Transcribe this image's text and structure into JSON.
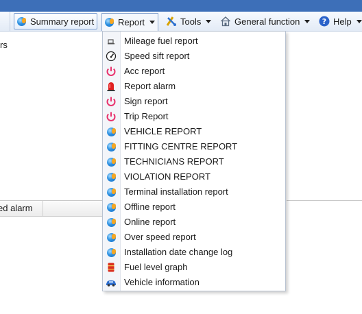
{
  "toolbar": {
    "items": [
      {
        "label": "Summary report",
        "icon": "globe-icon"
      },
      {
        "label": "Report",
        "icon": "globe-icon"
      },
      {
        "label": "Tools",
        "icon": "tools-icon"
      },
      {
        "label": "General function",
        "icon": "home-icon"
      },
      {
        "label": "Help",
        "icon": "help-icon"
      }
    ]
  },
  "left_panel": {
    "text": "rs"
  },
  "grid": {
    "column_header": "ed alarm"
  },
  "report_menu": {
    "items": [
      {
        "label": "Mileage fuel report",
        "icon": "fuel-pump-icon"
      },
      {
        "label": "Speed sift report",
        "icon": "speedometer-icon"
      },
      {
        "label": "Acc report",
        "icon": "power-icon"
      },
      {
        "label": "Report alarm",
        "icon": "alarm-siren-icon"
      },
      {
        "label": "Sign report",
        "icon": "power-icon"
      },
      {
        "label": "Trip Report",
        "icon": "power-icon"
      },
      {
        "label": "VEHICLE REPORT",
        "icon": "globe-icon"
      },
      {
        "label": "FITTING CENTRE REPORT",
        "icon": "globe-icon"
      },
      {
        "label": "TECHNICIANS REPORT",
        "icon": "globe-icon"
      },
      {
        "label": "VIOLATION REPORT",
        "icon": "globe-icon"
      },
      {
        "label": "Terminal installation report",
        "icon": "globe-icon"
      },
      {
        "label": "Offline report",
        "icon": "globe-icon"
      },
      {
        "label": "Online report",
        "icon": "globe-icon"
      },
      {
        "label": "Over speed report",
        "icon": "globe-icon"
      },
      {
        "label": "Installation date change log",
        "icon": "globe-icon"
      },
      {
        "label": "Fuel level graph",
        "icon": "fuel-barrel-icon"
      },
      {
        "label": "Vehicle information",
        "icon": "car-icon"
      }
    ]
  }
}
